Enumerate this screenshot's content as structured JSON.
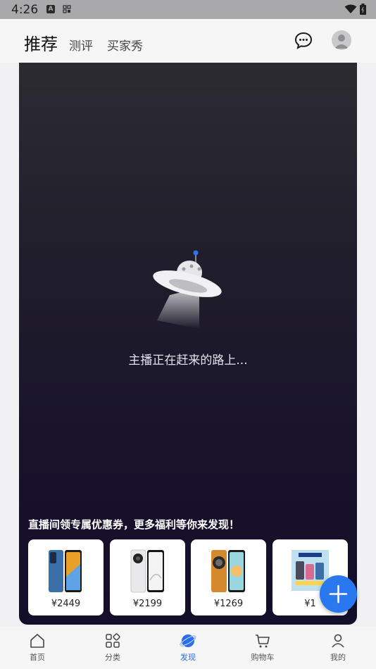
{
  "status_bar": {
    "time": "4:26",
    "icon_a": "A"
  },
  "header": {
    "tabs": [
      "推荐",
      "测评",
      "买家秀"
    ],
    "active_tab": 0
  },
  "live": {
    "empty_message": "主播正在赶来的路上...",
    "promo_text": "直播间领专属优惠券，更多福利等你来发现！",
    "products": [
      {
        "price": "¥2449"
      },
      {
        "price": "¥2199"
      },
      {
        "price": "¥1269"
      },
      {
        "price": "¥1"
      }
    ]
  },
  "bottom_nav": {
    "items": [
      {
        "label": "首页",
        "icon": "home-icon"
      },
      {
        "label": "分类",
        "icon": "category-icon"
      },
      {
        "label": "发现",
        "icon": "discover-icon"
      },
      {
        "label": "购物车",
        "icon": "cart-icon"
      },
      {
        "label": "我的",
        "icon": "profile-icon"
      }
    ],
    "active_index": 2
  },
  "colors": {
    "accent": "#2a6ef0",
    "fab": "#2a78f0"
  }
}
